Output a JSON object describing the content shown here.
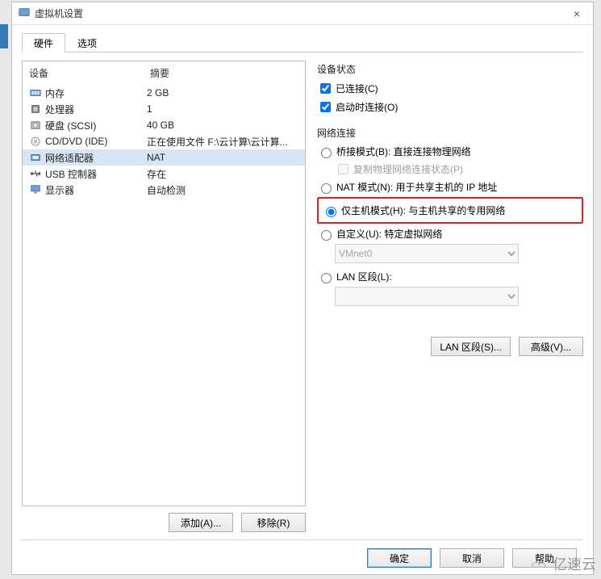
{
  "window": {
    "title": "虚拟机设置",
    "close": "×"
  },
  "tabs": {
    "hardware": "硬件",
    "options": "选项"
  },
  "hwlist": {
    "header_device": "设备",
    "header_summary": "摘要",
    "rows": [
      {
        "label": "内存",
        "summary": "2 GB",
        "icon": "memory"
      },
      {
        "label": "处理器",
        "summary": "1",
        "icon": "cpu"
      },
      {
        "label": "硬盘 (SCSI)",
        "summary": "40 GB",
        "icon": "hdd"
      },
      {
        "label": "CD/DVD (IDE)",
        "summary": "正在使用文件 F:\\云计算\\云计算...",
        "icon": "disc"
      },
      {
        "label": "网络适配器",
        "summary": "NAT",
        "icon": "nic",
        "selected": true
      },
      {
        "label": "USB 控制器",
        "summary": "存在",
        "icon": "usb"
      },
      {
        "label": "显示器",
        "summary": "自动检测",
        "icon": "display"
      }
    ]
  },
  "buttons": {
    "add": "添加(A)...",
    "remove": "移除(R)",
    "lan_segments": "LAN 区段(S)...",
    "advanced": "高级(V)...",
    "ok": "确定",
    "cancel": "取消",
    "help": "帮助"
  },
  "device_status": {
    "title": "设备状态",
    "connected": "已连接(C)",
    "connect_at_power_on": "启动时连接(O)"
  },
  "network": {
    "title": "网络连接",
    "bridged": "桥接模式(B): 直接连接物理网络",
    "replicate": "复制物理网络连接状态(P)",
    "nat": "NAT 模式(N): 用于共享主机的 IP 地址",
    "hostonly": "仅主机模式(H): 与主机共享的专用网络",
    "custom": "自定义(U): 特定虚拟网络",
    "vmnet_value": "VMnet0",
    "lan_segment": "LAN 区段(L):"
  },
  "watermark": "亿速云"
}
